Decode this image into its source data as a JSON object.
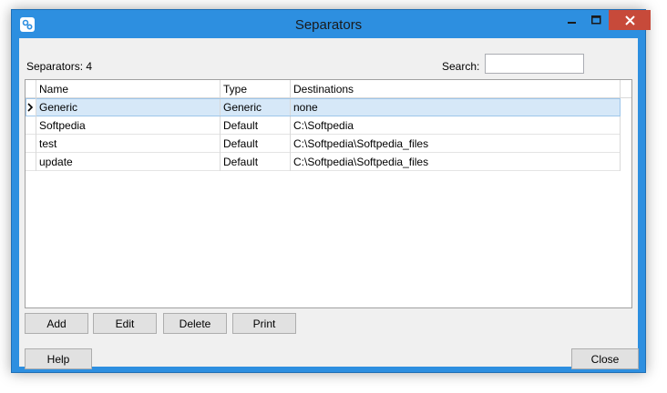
{
  "window": {
    "title": "Separators",
    "icon": "app-icon",
    "controls": [
      "minimize-icon",
      "maximize-icon",
      "close-icon"
    ],
    "accent": "#2d8fe0",
    "close_color": "#c74a3a"
  },
  "header": {
    "count_label": "Separators: 4",
    "search_label": "Search:",
    "search_value": ""
  },
  "grid": {
    "columns": [
      "Name",
      "Type",
      "Destinations"
    ],
    "rows": [
      {
        "name": "Generic",
        "type": "Generic",
        "destinations": "none",
        "selected": true
      },
      {
        "name": "Softpedia",
        "type": "Default",
        "destinations": "C:\\Softpedia",
        "selected": false
      },
      {
        "name": "test",
        "type": "Default",
        "destinations": "C:\\Softpedia\\Softpedia_files",
        "selected": false
      },
      {
        "name": "update",
        "type": "Default",
        "destinations": "C:\\Softpedia\\Softpedia_files",
        "selected": false
      }
    ],
    "selection_color": "#d6e8f8"
  },
  "buttons": {
    "add": "Add",
    "edit": "Edit",
    "delete": "Delete",
    "print": "Print",
    "help": "Help",
    "close": "Close"
  }
}
